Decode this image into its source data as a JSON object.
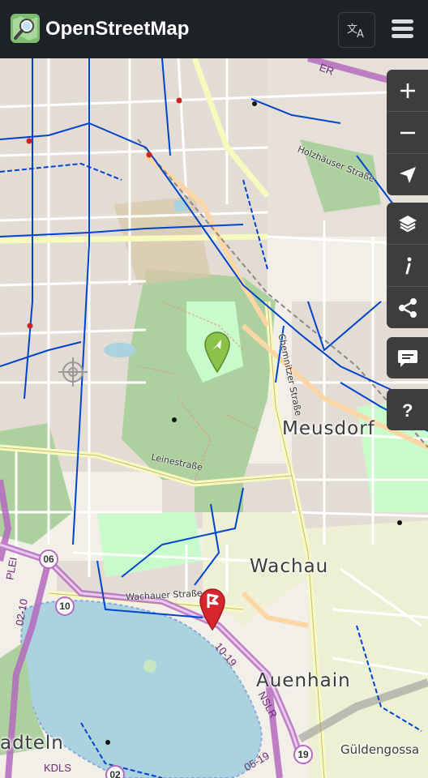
{
  "header": {
    "brand": "OpenStreetMap",
    "language_icon": "translate-icon",
    "menu_icon": "hamburger-menu-icon"
  },
  "map_controls": {
    "zoom": [
      "zoom-in-icon",
      "zoom-out-icon",
      "locate-icon"
    ],
    "tools": [
      "layers-icon",
      "info-icon",
      "share-icon"
    ],
    "note": "comment-icon",
    "help": "help-icon"
  },
  "places": {
    "meusdorf": "Meusdorf",
    "wachau": "Wachau",
    "auenhain": "Auenhain",
    "stoetteritz_partial": "adteln",
    "gueldengossa": "Güldengossa"
  },
  "streets": {
    "leinestrasse": "Leinestraße",
    "wachauer_strasse": "Wachauer Straße",
    "chemnitzer_strasse": "Chemnitzer Straße",
    "holzhaeuser_strasse": "Holzhäuser Straße"
  },
  "road_shields": [
    "06",
    "10",
    "19",
    "02"
  ],
  "road_refs": {
    "k1019": "10-19",
    "nslr": "NSLR",
    "k0519": "05-19",
    "k0210": "02-10",
    "kdls": "KDLS",
    "pleiße": "PLEI",
    "er": "ER"
  },
  "colors": {
    "header_bg": "#1e2227",
    "map_bg": "#f2efe9",
    "water": "#aad3df",
    "forest": "#add19e",
    "park": "#c8facc",
    "cycle_route": "#0044cc",
    "trunk_road": "#b56bbf",
    "control_bg": "#3d3d3d",
    "start_marker": "#8bc34a",
    "end_marker": "#d7262e"
  },
  "markers": {
    "start": "start-marker-icon",
    "end": "destination-marker-icon"
  }
}
